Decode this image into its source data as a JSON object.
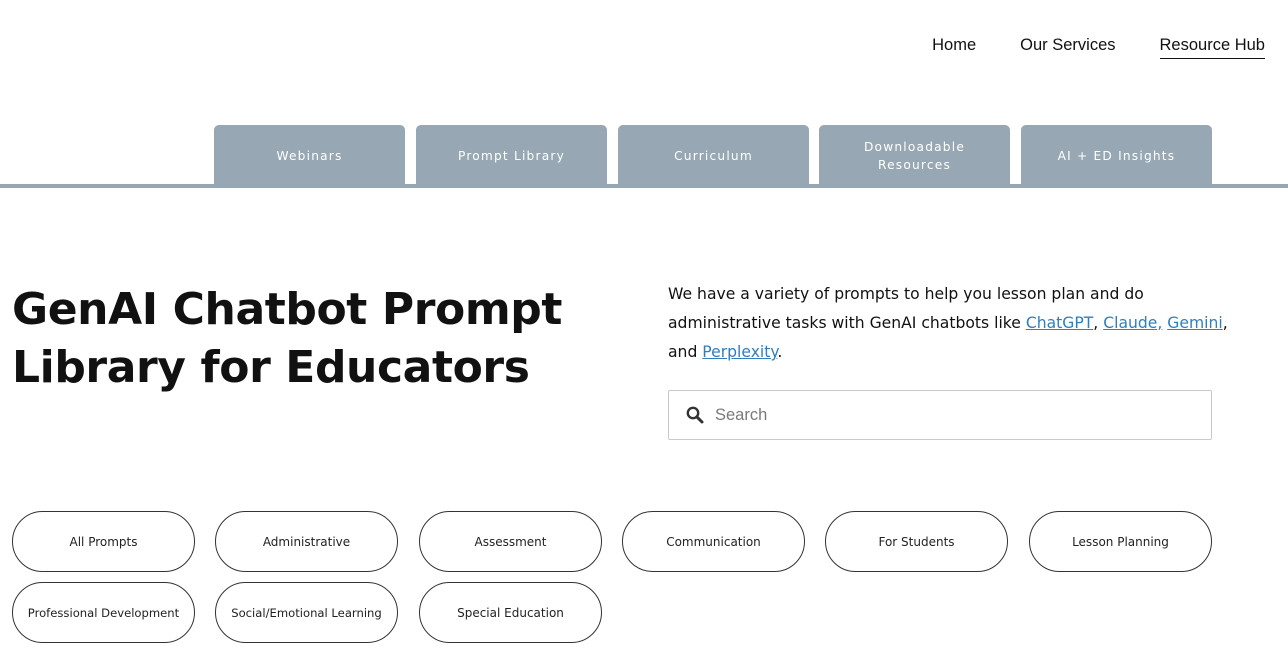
{
  "nav": {
    "items": [
      {
        "label": "Home"
      },
      {
        "label": "Our Services"
      },
      {
        "label": "Resource Hub"
      }
    ]
  },
  "tabs": [
    {
      "label": "Webinars"
    },
    {
      "label": "Prompt Library"
    },
    {
      "label": "Curriculum"
    },
    {
      "label": "Downloadable Resources"
    },
    {
      "label": "AI + ED Insights"
    }
  ],
  "hero": {
    "title": "GenAI Chatbot Prompt Library for Educators",
    "intro_prefix": "We have a variety of prompts to help you lesson plan and do administrative tasks with GenAI chatbots like ",
    "links": {
      "chatgpt": "ChatGPT",
      "claude": "Claude,",
      "gemini": "Gemini",
      "perplexity": "Perplexity"
    },
    "sep_comma": ",",
    "sep_and": ", and ",
    "end": "."
  },
  "search": {
    "placeholder": "Search",
    "value": "",
    "icon": "search-icon"
  },
  "categories": [
    {
      "label": "All Prompts"
    },
    {
      "label": "Administrative"
    },
    {
      "label": "Assessment"
    },
    {
      "label": "Communication"
    },
    {
      "label": "For Students"
    },
    {
      "label": "Lesson Planning"
    },
    {
      "label": "Professional Development"
    },
    {
      "label": "Social/Emotional Learning"
    },
    {
      "label": "Special Education"
    }
  ],
  "colors": {
    "tab_bg": "#97a8b4",
    "link": "#2f7ec0"
  }
}
